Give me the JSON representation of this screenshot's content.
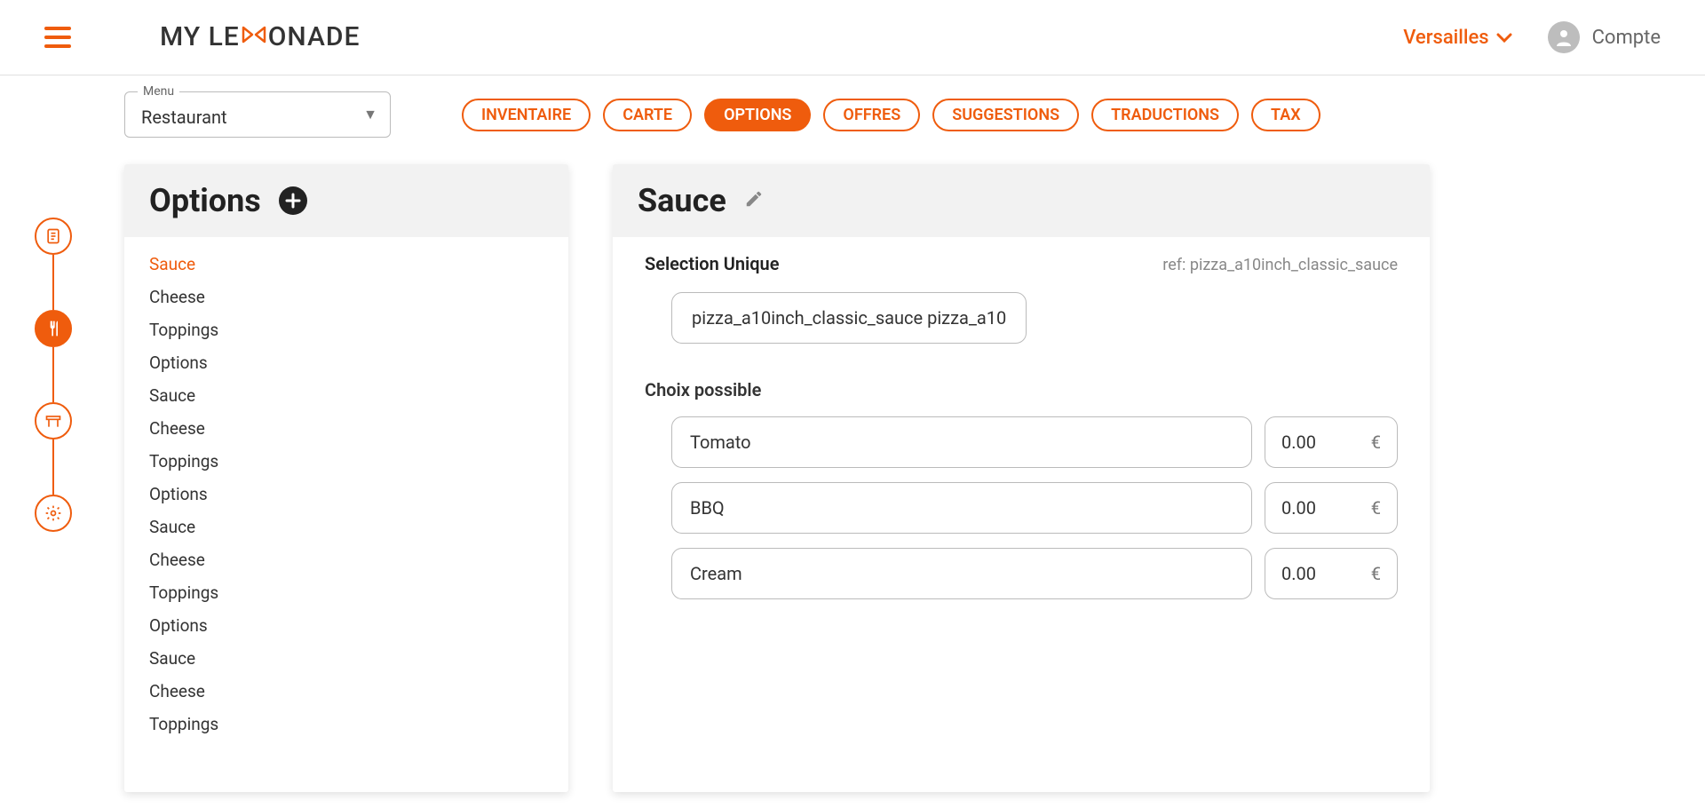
{
  "header": {
    "brand_left": "MY LE",
    "brand_right": "ONADE",
    "location": "Versailles",
    "account_label": "Compte"
  },
  "menu_selector": {
    "label": "Menu",
    "value": "Restaurant"
  },
  "tabs": [
    {
      "label": "INVENTAIRE",
      "active": false
    },
    {
      "label": "CARTE",
      "active": false
    },
    {
      "label": "OPTIONS",
      "active": true
    },
    {
      "label": "OFFRES",
      "active": false
    },
    {
      "label": "SUGGESTIONS",
      "active": false
    },
    {
      "label": "TRADUCTIONS",
      "active": false
    },
    {
      "label": "TAX",
      "active": false
    }
  ],
  "options_panel": {
    "title": "Options",
    "items": [
      {
        "label": "Sauce",
        "active": true
      },
      {
        "label": "Cheese",
        "active": false
      },
      {
        "label": "Toppings",
        "active": false
      },
      {
        "label": "Options",
        "active": false
      },
      {
        "label": "Sauce",
        "active": false
      },
      {
        "label": "Cheese",
        "active": false
      },
      {
        "label": "Toppings",
        "active": false
      },
      {
        "label": "Options",
        "active": false
      },
      {
        "label": "Sauce",
        "active": false
      },
      {
        "label": "Cheese",
        "active": false
      },
      {
        "label": "Toppings",
        "active": false
      },
      {
        "label": "Options",
        "active": false
      },
      {
        "label": "Sauce",
        "active": false
      },
      {
        "label": "Cheese",
        "active": false
      },
      {
        "label": "Toppings",
        "active": false
      }
    ]
  },
  "detail_panel": {
    "title": "Sauce",
    "selection_label": "Selection Unique",
    "ref_prefix": "ref:",
    "ref_value": "pizza_a10inch_classic_sauce",
    "ref_chip": "pizza_a10inch_classic_sauce pizza_a10",
    "choices_label": "Choix possible",
    "currency": "€",
    "choices": [
      {
        "name": "Tomato",
        "price": "0.00"
      },
      {
        "name": "BBQ",
        "price": "0.00"
      },
      {
        "name": "Cream",
        "price": "0.00"
      }
    ]
  }
}
